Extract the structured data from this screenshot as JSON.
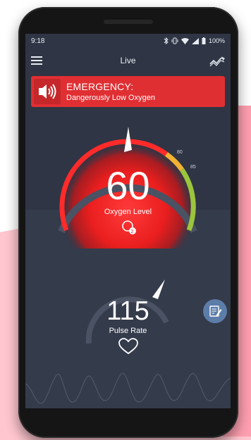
{
  "status_bar": {
    "time": "9:18",
    "battery": "100%",
    "icons": [
      "bluetooth-icon",
      "vibrate-icon",
      "wifi-icon",
      "signal-icon",
      "battery-icon"
    ]
  },
  "app_bar": {
    "title": "Live",
    "left_icon": "menu-icon",
    "right_icon": "trend-icon"
  },
  "alert": {
    "title": "EMERGENCY:",
    "message": "Dangerously Low Oxygen",
    "icon": "speaker-alarm-icon",
    "color": "#e02f33"
  },
  "oxygen": {
    "value": "60",
    "label": "Oxygen Level",
    "threshold_low": "80",
    "threshold_high": "85",
    "icon": "o2-icon",
    "accent": "#ff2a2a"
  },
  "pulse": {
    "value": "115",
    "label": "Pulse Rate",
    "icon": "heart-icon"
  },
  "actions": {
    "note_icon": "note-edit-icon",
    "note_color": "#5d7da9"
  },
  "colors": {
    "background": "#2f3544",
    "gauge_track": "#4a5263",
    "gauge_yellow": "#f2b233",
    "gauge_green": "#9bc53d"
  }
}
